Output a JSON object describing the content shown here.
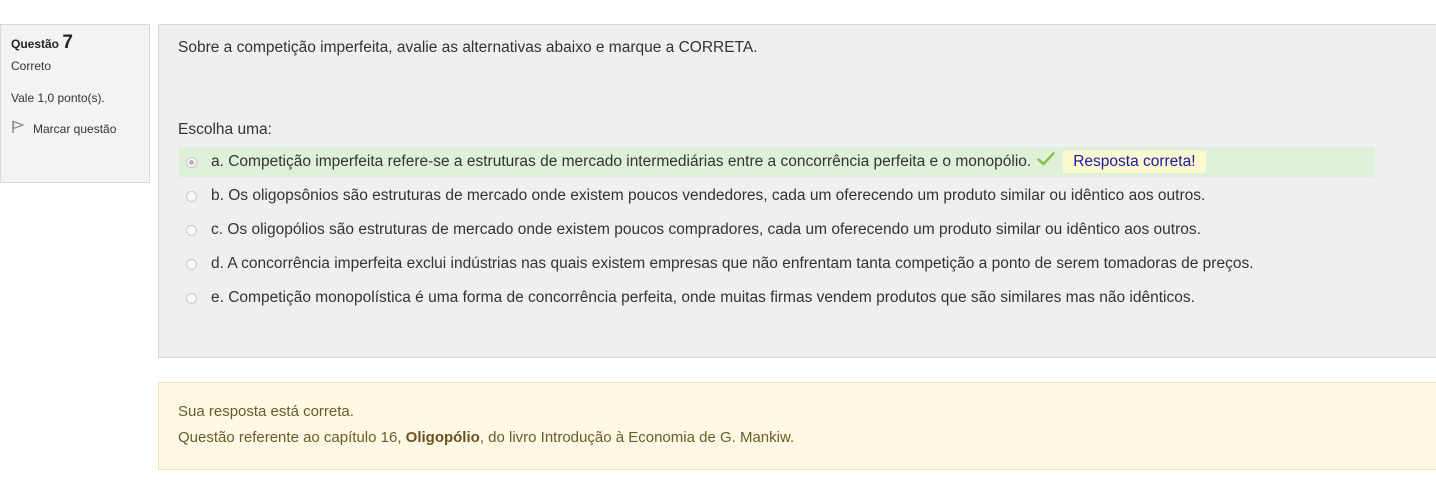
{
  "info": {
    "question_label": "Questão",
    "question_number": "7",
    "state": "Correto",
    "grade": "Vale 1,0 ponto(s).",
    "flag_label": "Marcar questão"
  },
  "question": {
    "text": "Sobre a competição imperfeita, avalie as alternativas abaixo e marque a CORRETA.",
    "prompt": "Escolha uma:",
    "options": [
      {
        "label": "a. Competição imperfeita refere-se a estruturas de mercado intermediárias entre a concorrência perfeita e o monopólio.",
        "selected": true,
        "correct": true,
        "feedback": "Resposta correta!"
      },
      {
        "label": "b. Os oligopsônios são estruturas de mercado onde existem poucos vendedores, cada um oferecendo um produto similar ou idêntico aos outros.",
        "selected": false
      },
      {
        "label": "c. Os oligopólios são estruturas de mercado onde existem poucos compradores, cada um oferecendo um produto similar ou idêntico aos outros.",
        "selected": false
      },
      {
        "label": "d. A concorrência imperfeita exclui indústrias nas quais existem empresas que não enfrentam tanta competição a ponto de serem tomadoras de preços.",
        "selected": false
      },
      {
        "label": "e. Competição monopolística é uma forma de concorrência perfeita, onde muitas firmas vendem produtos que são similares mas não idênticos.",
        "selected": false
      }
    ]
  },
  "outcome": {
    "line1": "Sua resposta está correta.",
    "line2_pre": "Questão referente ao capítulo 16, ",
    "line2_bold": "Oligopólio",
    "line2_post": ", do livro Introdução à Economia de G. Mankiw."
  },
  "colors": {
    "correct_bg": "#dff0d8",
    "check": "#8bc34a",
    "feedback_bg": "#fcf8d0",
    "feedback_text": "#1a1aa6",
    "outcome_bg": "#fcf8e3"
  },
  "icons": {
    "flag": "flag-icon",
    "check": "check-icon"
  }
}
